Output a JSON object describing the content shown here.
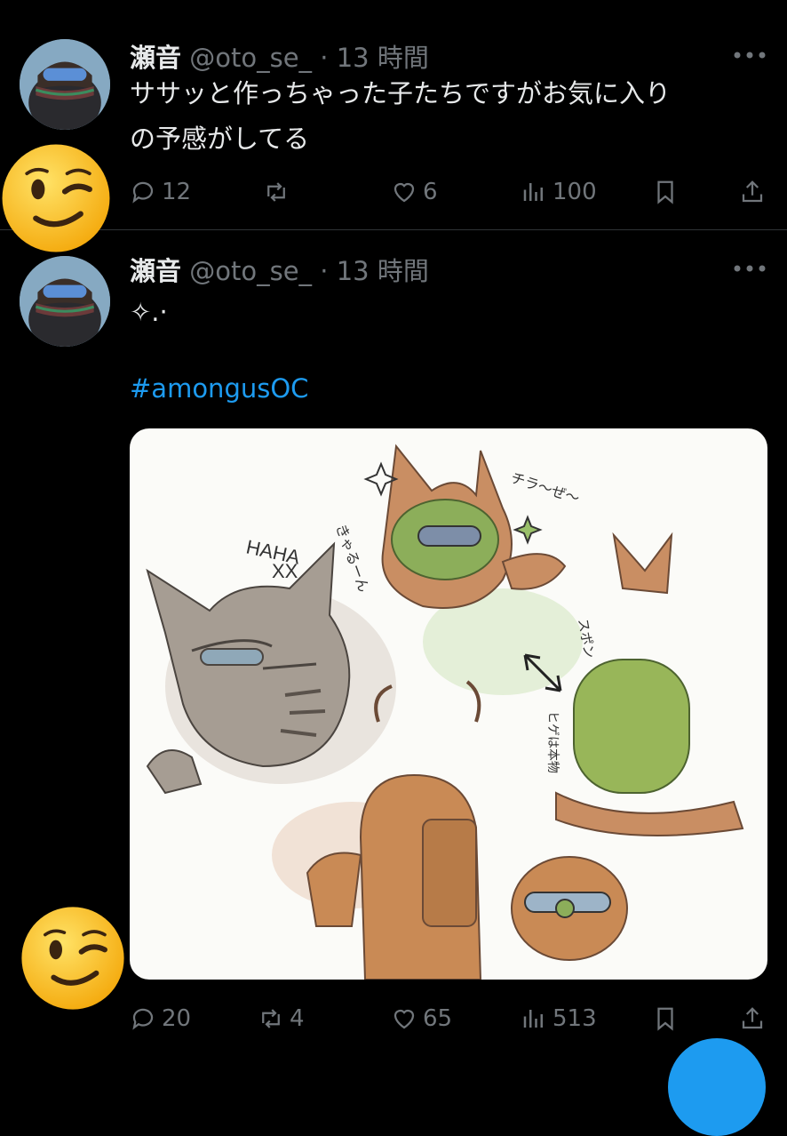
{
  "tweets": [
    {
      "display_name": "瀬音",
      "handle": "@oto_se_",
      "separator": "·",
      "time": "13 時間",
      "text_lines": [
        "ササッと作っちゃった子たちですがお気に入り",
        "の予感がしてる"
      ],
      "replies": "12",
      "retweets": "",
      "likes": "6",
      "views": "100"
    },
    {
      "display_name": "瀬音",
      "handle": "@oto_se_",
      "separator": "·",
      "time": "13 時間",
      "text_lines": [
        "✧.·"
      ],
      "hashtag": "#amongusOC",
      "replies": "20",
      "retweets": "4",
      "likes": "65",
      "views": "513"
    }
  ],
  "sketch_text": {
    "haha": "HAHA",
    "xx": "XX",
    "kyaru": "きゃるーん",
    "chirachira": "チラ〜ぜ〜",
    "suppon": "スポン",
    "hige": "ヒゲは本物"
  },
  "icons": {
    "more": "more-icon",
    "reply": "reply-icon",
    "retweet": "retweet-icon",
    "like": "like-icon",
    "views": "views-icon",
    "bookmark": "bookmark-icon",
    "share": "share-icon",
    "emoji": "winking-face-emoji",
    "compose": "compose-button"
  },
  "colors": {
    "background": "#000000",
    "text": "#e7e9ea",
    "muted": "#71767b",
    "link": "#1d9bf0",
    "divider": "#2f3336"
  }
}
